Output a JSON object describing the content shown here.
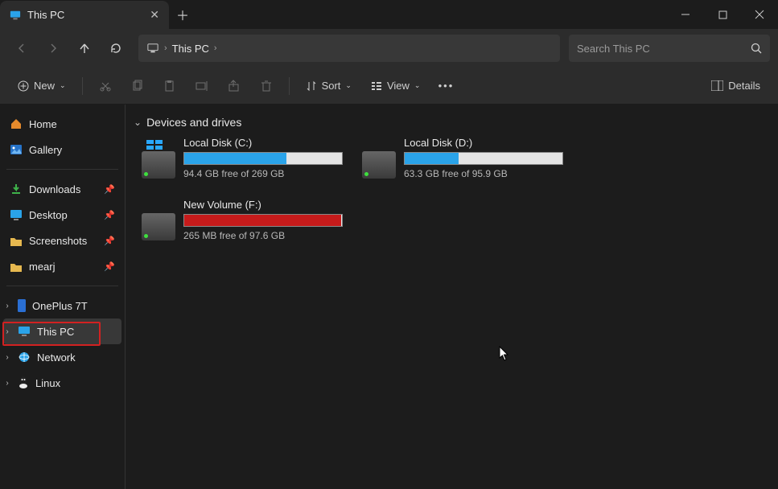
{
  "titlebar": {
    "tab_title": "This PC"
  },
  "address": {
    "location": "This PC"
  },
  "search": {
    "placeholder": "Search This PC"
  },
  "toolbar": {
    "new_label": "New",
    "sort_label": "Sort",
    "view_label": "View",
    "details_label": "Details"
  },
  "sidebar": {
    "home": "Home",
    "gallery": "Gallery",
    "pinned": [
      {
        "label": "Downloads"
      },
      {
        "label": "Desktop"
      },
      {
        "label": "Screenshots"
      },
      {
        "label": "mearj"
      }
    ],
    "tree": [
      {
        "label": "OnePlus 7T"
      },
      {
        "label": "This PC"
      },
      {
        "label": "Network"
      },
      {
        "label": "Linux"
      }
    ]
  },
  "content": {
    "section_title": "Devices and drives",
    "drives": [
      {
        "name": "Local Disk (C:)",
        "free_text": "94.4 GB free of 269 GB",
        "used_pct": 65,
        "color": "#2aa3e9",
        "win": true
      },
      {
        "name": "Local Disk (D:)",
        "free_text": "63.3 GB free of 95.9 GB",
        "used_pct": 34,
        "color": "#2aa3e9",
        "win": false
      },
      {
        "name": "New Volume (F:)",
        "free_text": "265 MB free of 97.6 GB",
        "used_pct": 99.7,
        "color": "#c61b1b",
        "win": false
      }
    ]
  }
}
